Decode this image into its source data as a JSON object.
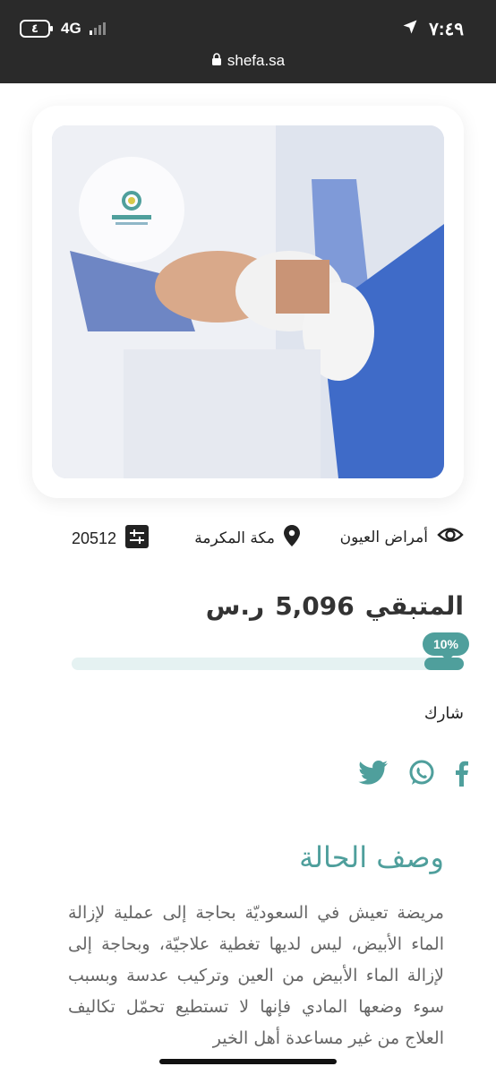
{
  "status_bar": {
    "battery": "٤",
    "network": "4G",
    "time": "٧:٤٩",
    "url": "shefa.sa"
  },
  "case": {
    "category": "أمراض العيون",
    "city": "مكة المكرمة",
    "case_id": "20512",
    "remaining_label": "المتبقي",
    "remaining_amount": "5,096",
    "currency": "ر.س",
    "progress_label": "10%",
    "progress_value": 0.1
  },
  "share": {
    "label": "شارك",
    "icons": [
      "twitter-icon",
      "whatsapp-icon",
      "facebook-icon"
    ]
  },
  "description": {
    "title": "وصف الحالة",
    "text": "مريضة تعيش في السعوديّة بحاجة إلى عملية لإزالة الماء الأبيض، ليس لديها تغطية علاجيّة، وبحاجة إلى لإزالة الماء الأبيض من العين وتركيب عدسة وبسبب سوء وضعها المادي فإنها لا تستطيع تحمّل تكاليف العلاج من غير مساعدة أهل الخير"
  },
  "colors": {
    "accent": "#4f9f9c",
    "status_bar": "#2a2a2a"
  }
}
